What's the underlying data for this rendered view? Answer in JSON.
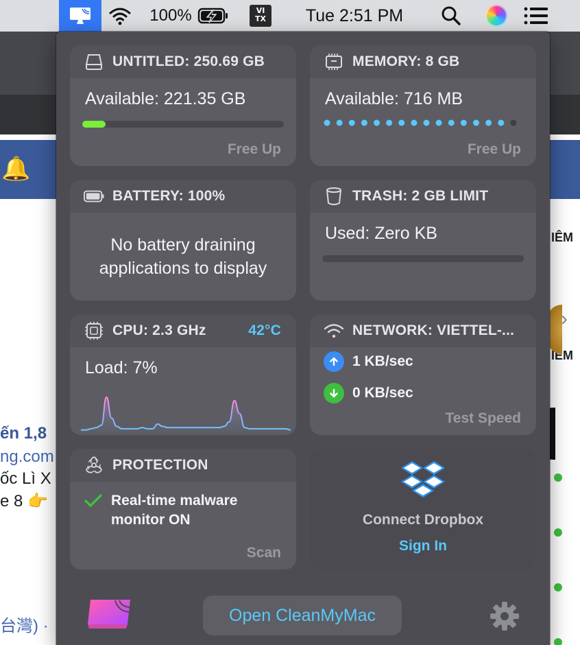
{
  "menubar": {
    "battery_percent": "100%",
    "input_source_line1": "VI",
    "input_source_line2": "TX",
    "clock": "Tue 2:51 PM",
    "icons": [
      "cleanmymac-menu-icon",
      "wifi-icon",
      "battery-charging-icon",
      "search-icon",
      "siri-icon",
      "control-center-icon"
    ]
  },
  "background": {
    "text_1": "ến 1,8",
    "text_2": "ng.com",
    "text_3": "ốc Lì X",
    "text_4": "e 8 👉",
    "text_5": "台灣) ·",
    "right_1": "IÊM",
    "right_2": "IÊM"
  },
  "cards": {
    "disk": {
      "title": "UNTITLED: 250.69 GB",
      "available": "Available: 221.35 GB",
      "used_fraction": 0.117,
      "action": "Free Up",
      "accent": "#7bed3a"
    },
    "memory": {
      "title": "MEMORY: 8 GB",
      "available": "Available: 716 MB",
      "dots_filled": 15,
      "dots_total": 16,
      "action": "Free Up",
      "accent": "#5ac8fa"
    },
    "battery": {
      "title": "BATTERY: 100%",
      "message_line1": "No battery draining",
      "message_line2": "applications to display"
    },
    "trash": {
      "title": "TRASH: 2 GB LIMIT",
      "used": "Used: Zero KB",
      "used_fraction": 0
    },
    "cpu": {
      "title": "CPU: 2.3 GHz",
      "temperature": "42°C",
      "load": "Load: 7%",
      "load_history": [
        2,
        2,
        3,
        4,
        6,
        30,
        12,
        5,
        3,
        3,
        3,
        3,
        4,
        3,
        3,
        7,
        5,
        4,
        4,
        4,
        4,
        4,
        4,
        4,
        4,
        4,
        4,
        4,
        5,
        9,
        27,
        16,
        4,
        3,
        3,
        3,
        3,
        3,
        3,
        3,
        3,
        2
      ]
    },
    "network": {
      "title": "NETWORK: VIETTEL-...",
      "upload": "1 KB/sec",
      "download": "0 KB/sec",
      "action": "Test Speed"
    },
    "protection": {
      "title": "PROTECTION",
      "status_line1": "Real-time malware",
      "status_line2": "monitor ON",
      "action": "Scan"
    },
    "dropbox": {
      "title": "Connect Dropbox",
      "action": "Sign In"
    }
  },
  "footer": {
    "open_button": "Open CleanMyMac"
  },
  "colors": {
    "panel_bg": "#4d4c52",
    "card_bg": "#5c5c62",
    "link": "#5ac8fa",
    "menubar_highlight": "#3478f6"
  }
}
